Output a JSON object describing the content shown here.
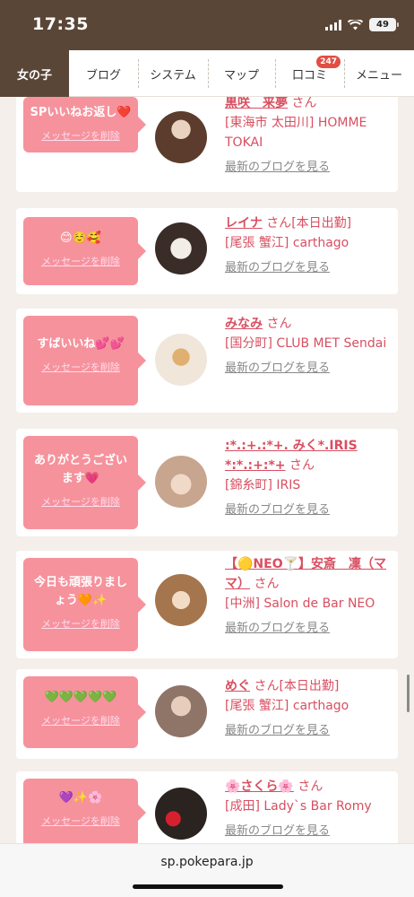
{
  "status_bar": {
    "time": "17:35",
    "battery": "49"
  },
  "tabs": [
    {
      "label": "女の子",
      "active": true
    },
    {
      "label": "ブログ"
    },
    {
      "label": "システム"
    },
    {
      "label": "マップ"
    },
    {
      "label": "口コミ",
      "badge": "247"
    },
    {
      "label": "メニュー"
    }
  ],
  "cards": [
    {
      "message": "SPいいねお返し❤️",
      "delete": "メッセージを削除",
      "name": "黒咲　来夢",
      "san": "さん",
      "status": "",
      "shop": "[東海市 太田川] HOMME TOKAI",
      "more": "最新のブログを見る"
    },
    {
      "message": "😊☺️🥰",
      "delete": "メッセージを削除",
      "name": "レイナ",
      "san": "さん",
      "status": "[本日出勤]",
      "shop": "[尾張 蟹江] carthago",
      "more": "最新のブログを見る"
    },
    {
      "message": "すばいいね💕💕",
      "delete": "メッセージを削除",
      "name": "みなみ",
      "san": "さん",
      "status": "",
      "shop": "[国分町] CLUB MET Sendai",
      "more": "最新のブログを見る"
    },
    {
      "message": "ありがとうございます💗",
      "delete": "メッセージを削除",
      "name": ":*.:+.:*+. みく*.IRIS *:*.:+:*+",
      "san": "さん",
      "status": "",
      "shop": "[錦糸町] IRIS",
      "more": "最新のブログを見る"
    },
    {
      "message": "今日も頑張りましょう🧡✨",
      "delete": "メッセージを削除",
      "name": "【🟡NEO🍸】安斎　凜（ママ）",
      "san": "さん",
      "status": "",
      "shop": "[中洲] Salon de Bar NEO",
      "more": "最新のブログを見る"
    },
    {
      "message": "💚💚💚💚💚",
      "delete": "メッセージを削除",
      "name": "めぐ",
      "san": "さん",
      "status": "[本日出勤]",
      "shop": "[尾張 蟹江] carthago",
      "more": "最新のブログを見る"
    },
    {
      "message": "💜✨🌸",
      "delete": "メッセージを削除",
      "name": "🌸さくら🌸",
      "san": "さん",
      "status": "",
      "shop": "[成田] Lady`s Bar Romy",
      "more": "最新のブログを見る"
    }
  ],
  "url_bar": {
    "url": "sp.pokepara.jp"
  }
}
